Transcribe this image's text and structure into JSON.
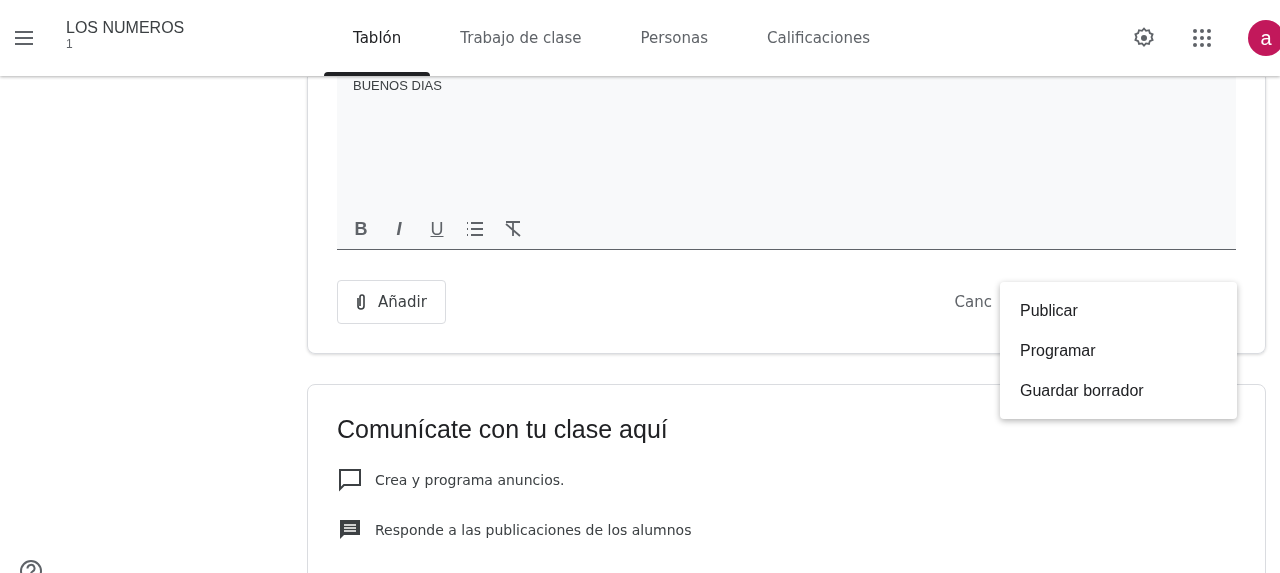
{
  "header": {
    "class_name": "LOS NUMEROS",
    "section": "1",
    "tabs": [
      {
        "label": "Tablón",
        "selected": true
      },
      {
        "label": "Trabajo de clase",
        "selected": false
      },
      {
        "label": "Personas",
        "selected": false
      },
      {
        "label": "Calificaciones",
        "selected": false
      }
    ],
    "avatar": {
      "letter": "a",
      "color": "#c2185b"
    }
  },
  "composer": {
    "text": "BUENOS DIAS",
    "format_buttons": [
      {
        "kind": "text",
        "label": "B"
      },
      {
        "kind": "text",
        "label": "I"
      },
      {
        "kind": "text",
        "label": "U"
      },
      {
        "kind": "list"
      },
      {
        "kind": "clear"
      }
    ],
    "add_button": "Añadir",
    "cancel_button": "Canc"
  },
  "post_menu": {
    "items": [
      "Publicar",
      "Programar",
      "Guardar borrador"
    ]
  },
  "info_card": {
    "title": "Comunícate con tu clase aquí",
    "items": [
      {
        "kind": "outline",
        "text": "Crea y programa anuncios."
      },
      {
        "kind": "filled",
        "text": "Responde a las publicaciones de los alumnos"
      }
    ]
  }
}
